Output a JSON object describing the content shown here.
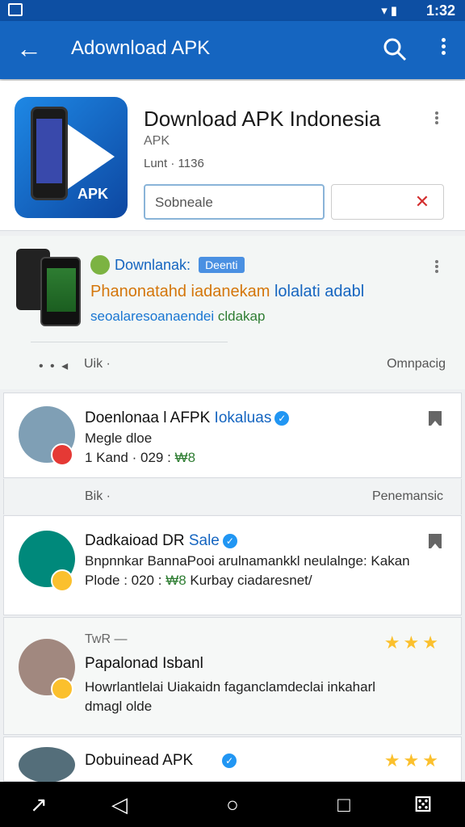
{
  "status": {
    "time": "1:32"
  },
  "appbar": {
    "title": "Adownload APK"
  },
  "app": {
    "title": "Download APK Indonesia",
    "sub1": "APK",
    "sub2": "Lunt · 1136",
    "icon_label": "APK",
    "primary_button": "Sobneale"
  },
  "post": {
    "author": "Downlanak:",
    "tag": "Deenti",
    "line1a": "Phanonatahd iadanekam ",
    "line1b": "lolalati adabl",
    "line2a": "seoalaresoanaendei ",
    "line2b": "cldakap",
    "actions": {
      "dots": "• • ◂",
      "like": "Uik · ",
      "right": "Omnpacig"
    }
  },
  "items": [
    {
      "title": "Doenlonaa l AFPK ",
      "title_blue": "Iokaluas",
      "line1": "Megle dloe",
      "line2a": "1 Kand · 029 : ",
      "line2b": "₩8",
      "sub_like": "Bik · ",
      "sub_right": "Penemansic"
    },
    {
      "title": "Dadkaioad DR ",
      "title_blue": "Sale",
      "line1": "Bnpnnkar BannaPooi ",
      "line1b": "arulnamankkl neulalnge: Kakan",
      "line2a": "Plode : 020 : ",
      "line2b": "₩8",
      "line2c": " Kurbay ciadaresnet/"
    },
    {
      "mini": "TwR —",
      "title": "Papalonad Isbanl",
      "line1": "Howrlantlelai ",
      "line1b": "Uiakaidn faganclamdeclai inkaharl",
      "line2": "dmagl olde"
    },
    {
      "title": "Dobuinead APK"
    }
  ],
  "colors": {
    "primary": "#1565c0",
    "accent": "#fbc02d"
  }
}
